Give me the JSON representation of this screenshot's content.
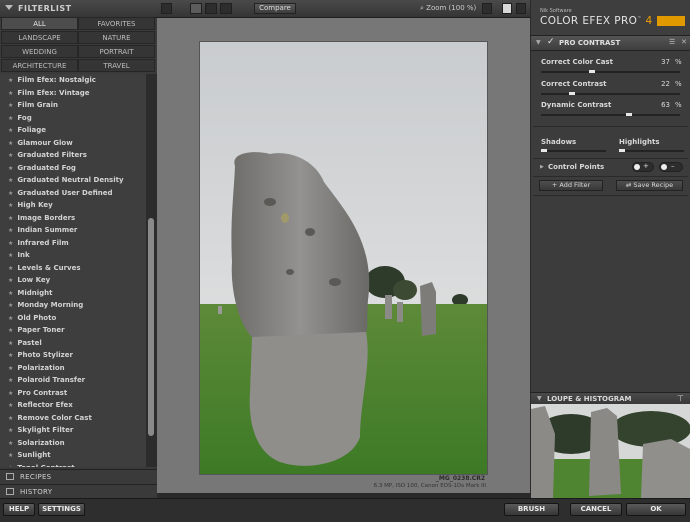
{
  "left_panel": {
    "title": "FILTERLIST",
    "categories": [
      "ALL",
      "FAVORITES",
      "LANDSCAPE",
      "NATURE",
      "WEDDING",
      "PORTRAIT",
      "ARCHITECTURE",
      "TRAVEL"
    ],
    "selected_category": "ALL",
    "filters": [
      "Film Efex: Nostalgic",
      "Film Efex: Vintage",
      "Film Grain",
      "Fog",
      "Foliage",
      "Glamour Glow",
      "Graduated Filters",
      "Graduated Fog",
      "Graduated Neutral Density",
      "Graduated User Defined",
      "High Key",
      "Image Borders",
      "Indian Summer",
      "Infrared Film",
      "Ink",
      "Levels & Curves",
      "Low Key",
      "Midnight",
      "Monday Morning",
      "Old Photo",
      "Paper Toner",
      "Pastel",
      "Photo Stylizer",
      "Polarization",
      "Polaroid Transfer",
      "Pro Contrast",
      "Reflector Efex",
      "Remove Color Cast",
      "Skylight Filter",
      "Solarization",
      "Sunlight",
      "Tonal Contrast"
    ],
    "recipes_label": "RECIPES",
    "history_label": "HISTORY"
  },
  "toolbar": {
    "compare_label": "Compare",
    "zoom_label": "Zoom (100 %)"
  },
  "canvas": {
    "filename": "_MG_0238.CR2",
    "meta": "6.3 MP, ISO 100, Canon EOS-1Ds Mark III"
  },
  "right_panel": {
    "brand_small": "Nik Software",
    "brand_main": "COLOR EFEX PRO",
    "brand_version": "4",
    "filter_title": "PRO CONTRAST",
    "sliders": [
      {
        "label": "Correct Color Cast",
        "value": "37",
        "unit": "%",
        "level": 0.37
      },
      {
        "label": "Correct Contrast",
        "value": "22",
        "unit": "%",
        "level": 0.22
      },
      {
        "label": "Dynamic Contrast",
        "value": "63",
        "unit": "%",
        "level": 0.63
      }
    ],
    "shadows_label": "Shadows",
    "highlights_label": "Highlights",
    "control_points_label": "Control Points",
    "add_filter_label": "Add Filter",
    "save_recipe_label": "Save Recipe",
    "loupe_label": "LOUPE & HISTOGRAM"
  },
  "bottom_bar": {
    "help_label": "HELP",
    "settings_label": "SETTINGS",
    "brush_label": "BRUSH",
    "cancel_label": "CANCEL",
    "ok_label": "OK"
  },
  "colors": {
    "accent": "#f0a000",
    "panel_bg": "#3c3c3c",
    "canvas_bg": "#777777"
  }
}
